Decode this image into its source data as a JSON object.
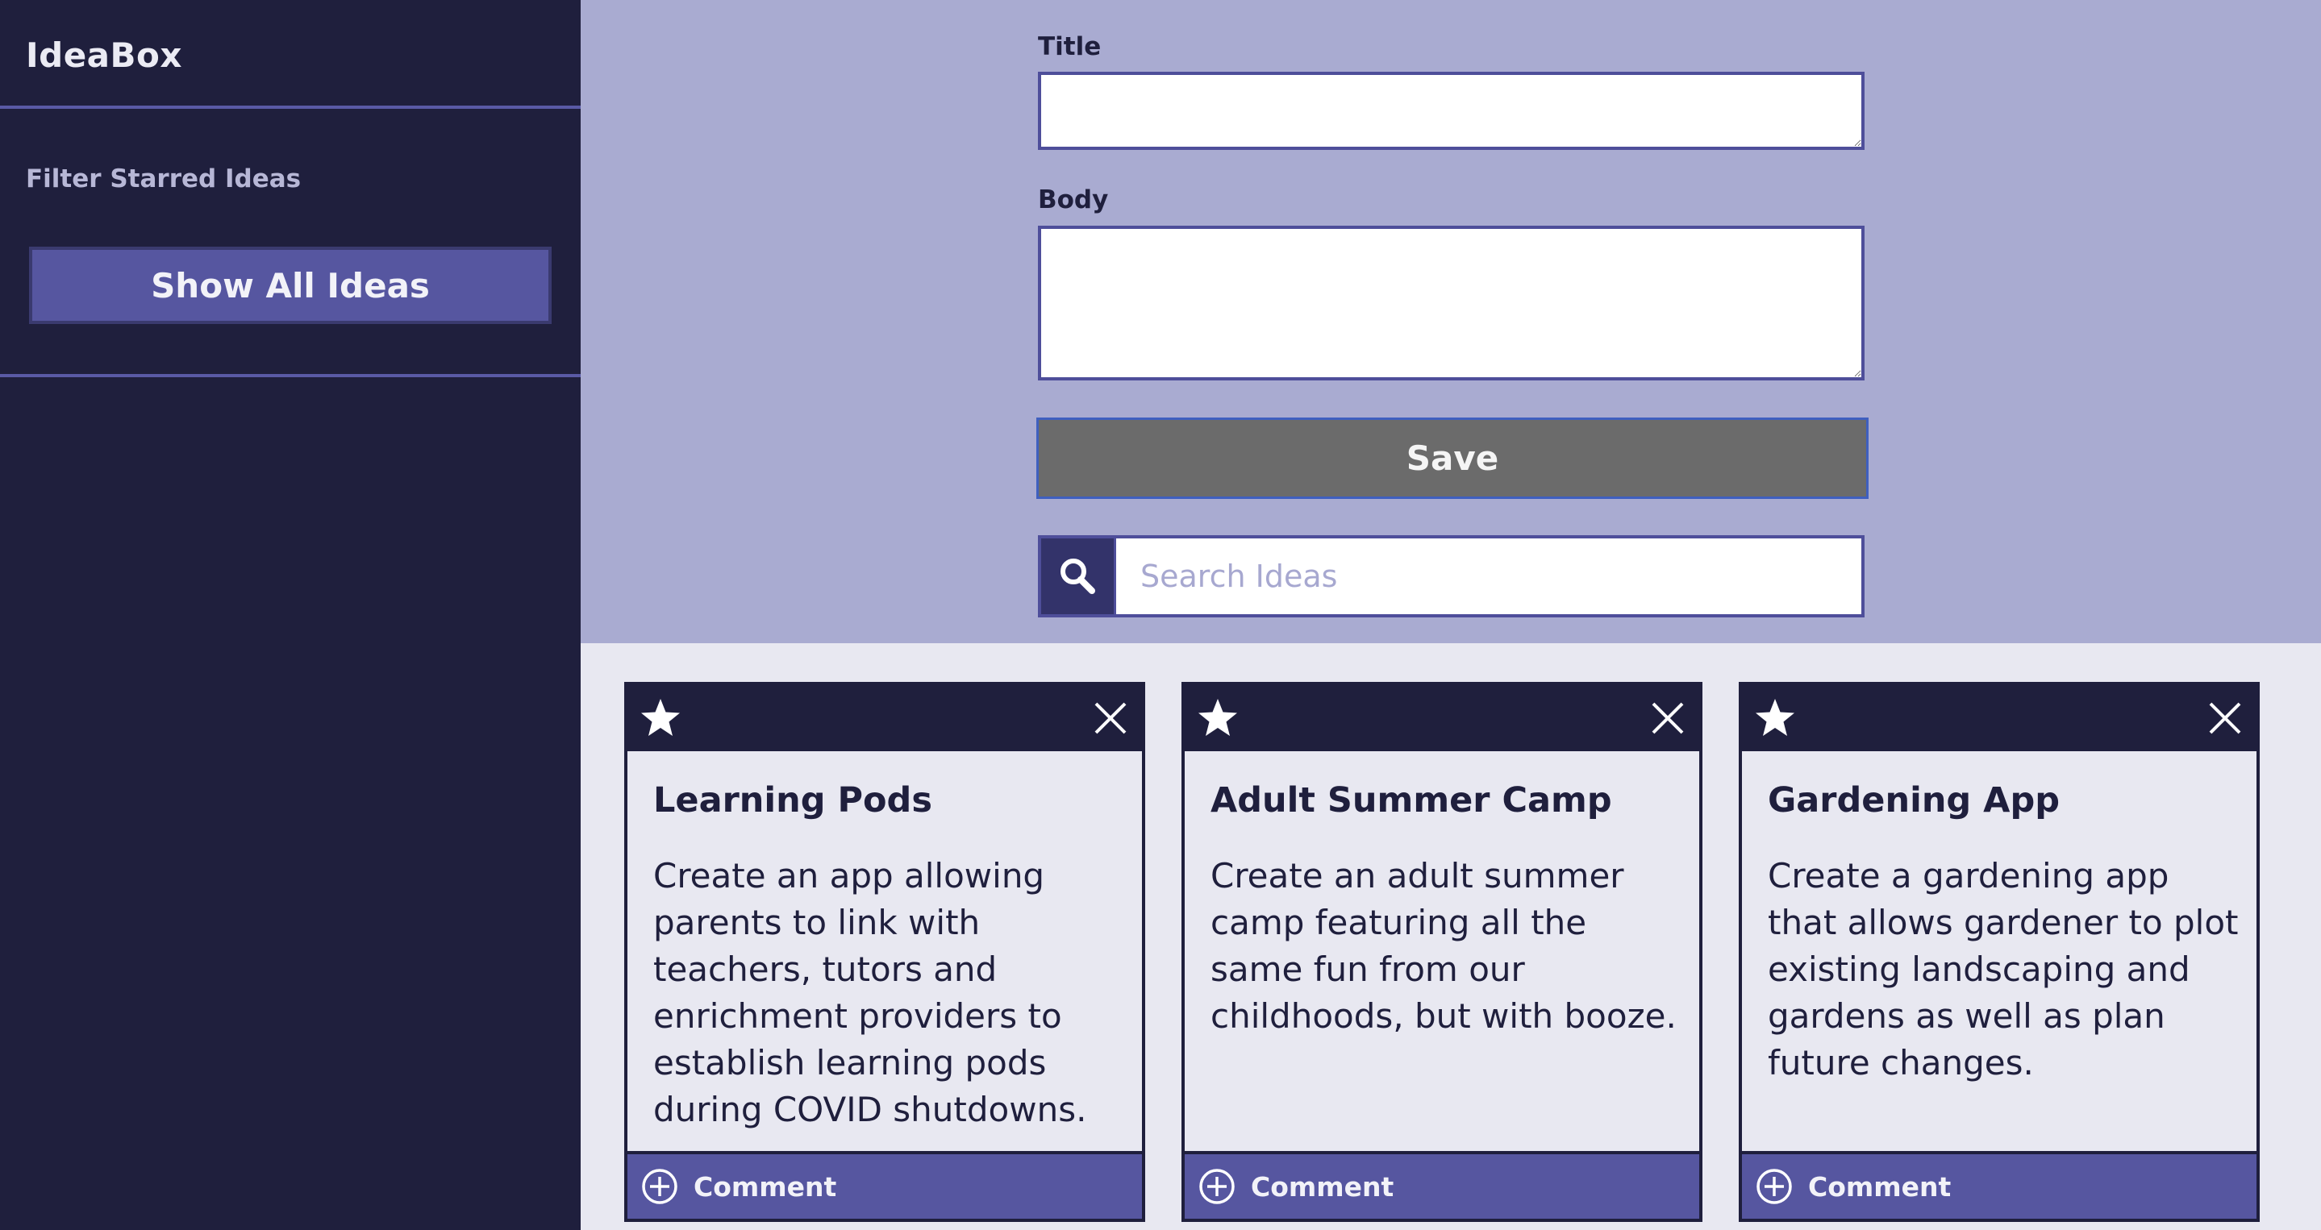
{
  "app": {
    "name": "IdeaBox"
  },
  "sidebar": {
    "filter_label": "Filter Starred Ideas",
    "show_all_label": "Show All Ideas"
  },
  "form": {
    "title_label": "Title",
    "title_value": "",
    "body_label": "Body",
    "body_value": "",
    "save_label": "Save",
    "search_placeholder": "Search Ideas",
    "search_value": ""
  },
  "cards": [
    {
      "title": "Learning Pods",
      "body": "Create an app allowing parents to link with teachers, tutors and enrichment providers to establish learning pods during COVID shutdowns.",
      "comment_label": "Comment"
    },
    {
      "title": "Adult Summer Camp",
      "body": "Create an adult summer camp featuring all the same fun from our childhoods, but with booze.",
      "comment_label": "Comment"
    },
    {
      "title": "Gardening App",
      "body": "Create a gardening app that allows gardener to plot existing landscaping and gardens as well as plan future changes.",
      "comment_label": "Comment"
    }
  ],
  "icons": {
    "star": "star-icon",
    "close": "close-icon",
    "comment": "plus-circle-icon",
    "search": "search-icon"
  },
  "colors": {
    "sidebar_bg": "#1f1f3d",
    "form_bg": "#a9abd1",
    "accent": "#5656a0",
    "save_bg": "#6b6b6b",
    "card_bg": "#e8e8f1"
  }
}
